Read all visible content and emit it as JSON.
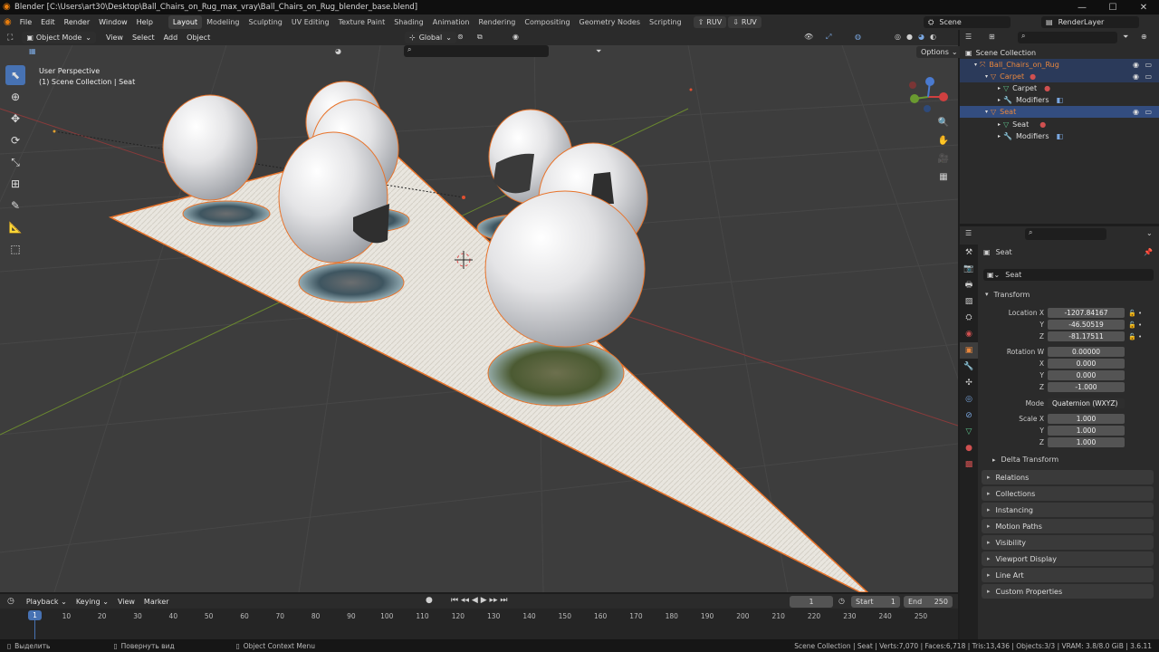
{
  "window": {
    "title": "Blender [C:\\Users\\art30\\Desktop\\Ball_Chairs_on_Rug_max_vray\\Ball_Chairs_on_Rug_blender_base.blend]",
    "min": "—",
    "max": "☐",
    "close": "✕"
  },
  "menu": [
    "File",
    "Edit",
    "Render",
    "Window",
    "Help"
  ],
  "workspaces": [
    "Layout",
    "Modeling",
    "Sculpting",
    "UV Editing",
    "Texture Paint",
    "Shading",
    "Animation",
    "Rendering",
    "Compositing",
    "Geometry Nodes",
    "Scripting"
  ],
  "ruv1": "RUV",
  "ruv2": "RUV",
  "scene": "Scene",
  "render_layer": "RenderLayer",
  "viewport_header": {
    "mode": "Object Mode",
    "view": "View",
    "select": "Select",
    "add": "Add",
    "object": "Object",
    "orientation": "Global",
    "options": "Options"
  },
  "overlay_text": {
    "line1": "User Perspective",
    "line2": "(1) Scene Collection | Seat"
  },
  "outliner": {
    "root": "Scene Collection",
    "rows": [
      {
        "label": "Ball_Chairs_on_Rug",
        "color": "#e8873d"
      },
      {
        "label": "Carpet",
        "color": "#e8873d"
      },
      {
        "label": "Carpet",
        "color": "#ddd"
      },
      {
        "label": "Modifiers",
        "color": "#ddd"
      },
      {
        "label": "Seat",
        "color": "#e8873d"
      },
      {
        "label": "Seat",
        "color": "#ddd"
      },
      {
        "label": "Modifiers",
        "color": "#ddd"
      }
    ]
  },
  "properties": {
    "object_name": "Seat",
    "data_name": "Seat",
    "transform_label": "Transform",
    "location_x_label": "Location X",
    "location_x": "-1207.84167",
    "location_y_label": "Y",
    "location_y": "-46.50519",
    "location_z_label": "Z",
    "location_z": "-81.17511",
    "rotation_w_label": "Rotation W",
    "rotation_w": "0.00000",
    "rotation_x_label": "X",
    "rotation_x": "0.000",
    "rotation_y_label": "Y",
    "rotation_y": "0.000",
    "rotation_z_label": "Z",
    "rotation_z": "-1.000",
    "mode_label": "Mode",
    "mode": "Quaternion (WXYZ)",
    "scale_x_label": "Scale X",
    "scale_x": "1.000",
    "scale_y_label": "Y",
    "scale_y": "1.000",
    "scale_z_label": "Z",
    "scale_z": "1.000",
    "delta_transform": "Delta Transform",
    "sections": [
      "Relations",
      "Collections",
      "Instancing",
      "Motion Paths",
      "Visibility",
      "Viewport Display",
      "Line Art",
      "Custom Properties"
    ]
  },
  "timeline": {
    "playback": "Playback",
    "keying": "Keying",
    "view": "View",
    "marker": "Marker",
    "current_frame": "1",
    "start_label": "Start",
    "start": "1",
    "end_label": "End",
    "end": "250",
    "ticks": [
      "1",
      "10",
      "20",
      "30",
      "40",
      "50",
      "60",
      "70",
      "80",
      "90",
      "100",
      "110",
      "120",
      "130",
      "140",
      "150",
      "160",
      "170",
      "180",
      "190",
      "200",
      "210",
      "220",
      "230",
      "240",
      "250"
    ]
  },
  "statusbar": {
    "select": "Выделить",
    "rotate": "Повернуть вид",
    "context": "Object Context Menu",
    "stats": "Scene Collection | Seat | Verts:7,070 | Faces:6,718 | Tris:13,436 | Objects:3/3 | VRAM: 3.8/8.0 GiB | 3.6.11"
  }
}
